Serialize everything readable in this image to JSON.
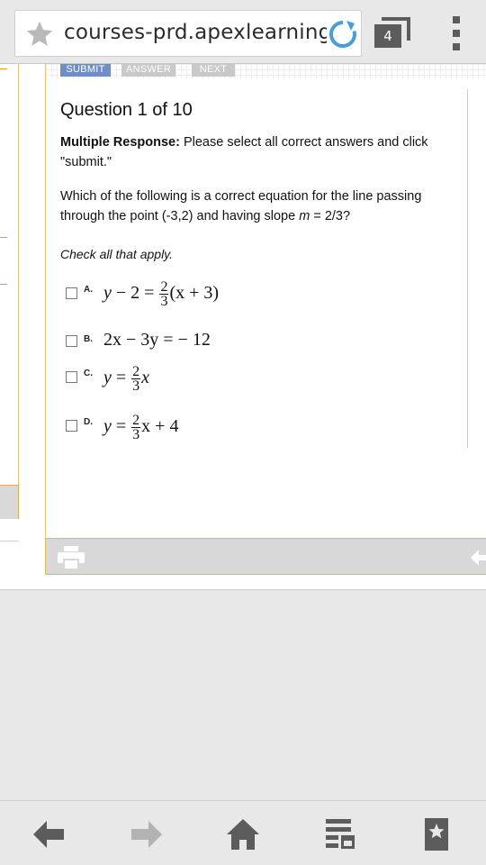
{
  "browser": {
    "url": "courses-prd.apexlearning",
    "tab_count": "4",
    "colors": {
      "chrome": "#e8e8e8",
      "icon": "#5c5c5c",
      "reload": "#4a9ed8"
    }
  },
  "toolbar": {
    "submit_label": "SUBMIT",
    "answer_label": "ANSWER",
    "next_label": "NEXT",
    "submit_color": "#6f8fc4"
  },
  "question": {
    "title": "Question 1 of 10",
    "type_label": "Multiple Response:",
    "instructions": " Please select all correct answers and click \"submit.\"",
    "text_before": "Which of the following is a correct equation for the line passing through the point (-3,2) and having slope ",
    "slope_var": "m",
    "text_after": " = 2/3?",
    "check_all": "Check all that apply."
  },
  "options": [
    {
      "letter": "A.",
      "eq": {
        "lhs_var": "y",
        "lhs_rest": " − 2 = ",
        "num": "2",
        "den": "3",
        "rhs": "(x + 3)"
      }
    },
    {
      "letter": "B.",
      "eq": {
        "text": "2x − 3y = − 12"
      }
    },
    {
      "letter": "C.",
      "eq": {
        "lhs_var": "y",
        "lhs_rest": " = ",
        "num": "2",
        "den": "3",
        "rhs": "x"
      }
    },
    {
      "letter": "D.",
      "eq": {
        "lhs_var": "y",
        "lhs_rest": " = ",
        "num": "2",
        "den": "3",
        "rhs": "x + 4"
      }
    }
  ],
  "icons": {
    "favorite": "star-icon",
    "reload": "reload-icon",
    "tabs": "tabs-icon",
    "menu": "overflow-menu-icon",
    "print": "print-icon",
    "back": "arrow-back-icon",
    "forward": "arrow-forward-icon",
    "home": "home-icon",
    "reading_list": "reading-list-icon",
    "bookmarks": "bookmarks-icon"
  }
}
